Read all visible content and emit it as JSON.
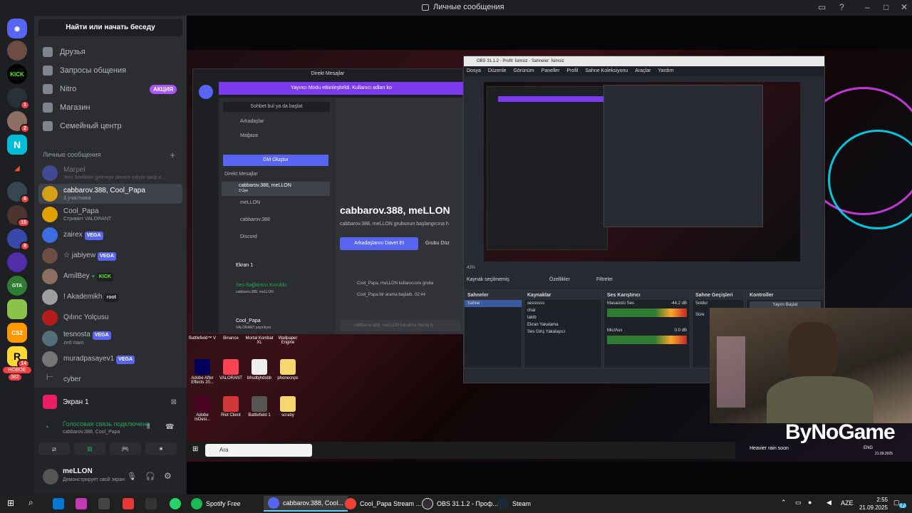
{
  "window": {
    "title": "Личные сообщения"
  },
  "sidebar": {
    "search": "Найти или начать беседу",
    "nav": [
      {
        "label": "Друзья"
      },
      {
        "label": "Запросы общения"
      },
      {
        "label": "Nitro",
        "badge": "АКЦИЯ"
      },
      {
        "label": "Магазин"
      },
      {
        "label": "Семейный центр"
      }
    ],
    "section": "Личные сообщения",
    "dms": [
      {
        "name": "Marpel",
        "sub": "Yeni özellikler gelmeye devam ediyor takip e...",
        "color": "#5865f2"
      },
      {
        "name": "cabbarov.388, Cool_Papa",
        "sub": "3 участника",
        "color": "#d4a017",
        "active": true
      },
      {
        "name": "Cool_Papa",
        "sub": "Стримит VALORANT",
        "color": "#e0a000"
      },
      {
        "name": "zairex",
        "tag": "VEGA",
        "color": "#3b6ee0"
      },
      {
        "name": "☆ jabiyew",
        "tag": "VEGA",
        "color": "#6d4c41"
      },
      {
        "name": "AmilBey",
        "tag": "KICK",
        "tagtype": "kick",
        "color": "#8d6e63"
      },
      {
        "name": "! Akademikh",
        "tag": "root",
        "tagtype": "root",
        "color": "#9e9e9e"
      },
      {
        "name": "Qılınc Yolçusu",
        "color": "#b71c1c"
      },
      {
        "name": "tesnosta",
        "tag": "VEGA",
        "sub": "zed main",
        "color": "#546e7a"
      },
      {
        "name": "muradpasayev1",
        "tag": "VEGA",
        "color": "#757575"
      },
      {
        "name": "cyber",
        "color": "#424242"
      }
    ]
  },
  "screen_panel": {
    "label": "Экран 1"
  },
  "voice": {
    "status": "Голосовая связь подключена",
    "members": "cabbarov.388, Cool_Papa"
  },
  "user": {
    "name": "meLLON",
    "status": "Демонстрирует свой экран"
  },
  "stream": {
    "inner_discord": {
      "top": "Direkt Mesajlar",
      "banner": "Yayıncı Modu etkinleştirildi. Kullanıcı adları ko",
      "search": "Sohbet bul ya da başlat",
      "friends": "Arkadaşlar",
      "store": "Mağaza",
      "create": "DM Oluştur",
      "section": "Direkt Mesajlar",
      "group": "cabbarov.388, meLLON",
      "group_sub": "3 Üye",
      "dm2": "meLLON",
      "dm3": "cabbarov.388",
      "dm4": "Discord",
      "screen": "Ekran 1",
      "voice": "Ses Bağlantısı Kuruldu",
      "voice_sub": "cabbarov.388, meLLON",
      "user": "Cool_Papa",
      "user_sub": "VALORANT yayınlıyor",
      "heading": "cabbarov.388, meLLON",
      "desc": "cabbarov.388, meLLON grubunun başlangıcına h",
      "invite": "Arkadaşlarını Davet Et",
      "edit": "Grubu Düz",
      "msg1": "Cool_Papa, meLLON kullanıcısını gruba",
      "msg2": "Cool_Papa bir arama başlattı. 02:44",
      "input": "cabbarov.388, meLLON kanalına mesaj g"
    },
    "obs": {
      "title": "OBS 31.1.2 - Profil: İsimsiz - Sahneler: İsimsiz",
      "menu": [
        "Dosya",
        "Düzenle",
        "Görünüm",
        "Paneller",
        "Profil",
        "Sahne Koleksiyonu",
        "Araçlar",
        "Yardım"
      ],
      "nosource": "Kaynak seçilmemiş",
      "props": "Özellikler",
      "filters": "Filtreler",
      "scenes_hd": "Sahneler",
      "scene": "Sahne",
      "sources_hd": "Kaynaklar",
      "sources": [
        "sessssss",
        "chat",
        "takib",
        "Ekran Yakalama",
        "Ses Giriş Yakalayıcı"
      ],
      "mixer_hd": "Ses Karıştırıcı",
      "mixer1": "Masaüstü Ses",
      "mixer1_db": "-44.2 dB",
      "mixer2": "Mic/Aux",
      "mixer2_db": "0.0 dB",
      "trans_hd": "Sahne Geçişleri",
      "trans": "Soldur",
      "duration": "Süre",
      "controls_hd": "Kontroller",
      "start": "Yayını Başlat",
      "zoom": "43%"
    },
    "desktop": [
      {
        "label": "Battlefield™ V",
        "color": "#333"
      },
      {
        "label": "Binance",
        "color": "#f0b90b"
      },
      {
        "label": "Mortal Kombat XL",
        "color": "#222"
      },
      {
        "label": "Wallpaper Engine",
        "color": "#1e88e5"
      },
      {
        "label": "Adobe After Effects 20...",
        "color": "#00005b"
      },
      {
        "label": "VALORANT",
        "color": "#fa4454"
      },
      {
        "label": "bhsdbjhdsbb",
        "color": "#eee"
      },
      {
        "label": "phonecnpc",
        "color": "#f5d76e"
      },
      {
        "label": "Adobe InDesi...",
        "color": "#49021f"
      },
      {
        "label": "Riot Client",
        "color": "#d13639"
      },
      {
        "label": "Battlefield 1",
        "color": "#555"
      },
      {
        "label": "scraby",
        "color": "#f5d76e"
      }
    ],
    "win_search": "Ara",
    "weather": "Heavier rain soon",
    "lang": "ENG",
    "inner_date": "21.09.2025",
    "logo": "ByNoGame"
  },
  "taskbar": {
    "apps": [
      {
        "label": "Spotify Free",
        "color": "#1db954"
      },
      {
        "label": "cabbarov.388, Cool...",
        "color": "#5865f2",
        "active": true
      },
      {
        "label": "Cool_Papa Stream ...",
        "color": "#ea4335"
      },
      {
        "label": "OBS 31.1.2 - Проф...",
        "color": "#302e31"
      },
      {
        "label": "Steam",
        "color": "#1b2838"
      }
    ],
    "lang": "AZE",
    "time": "2:55",
    "date": "21.09.2025",
    "notif": "7"
  },
  "rail_badges": [
    "1",
    "2",
    "6",
    "15",
    "8",
    "14",
    "382"
  ],
  "rail_new": "НОВОЕ",
  "colors": {
    "accent": "#5865f2",
    "green": "#23a55a",
    "bg": "#1e1f22"
  }
}
